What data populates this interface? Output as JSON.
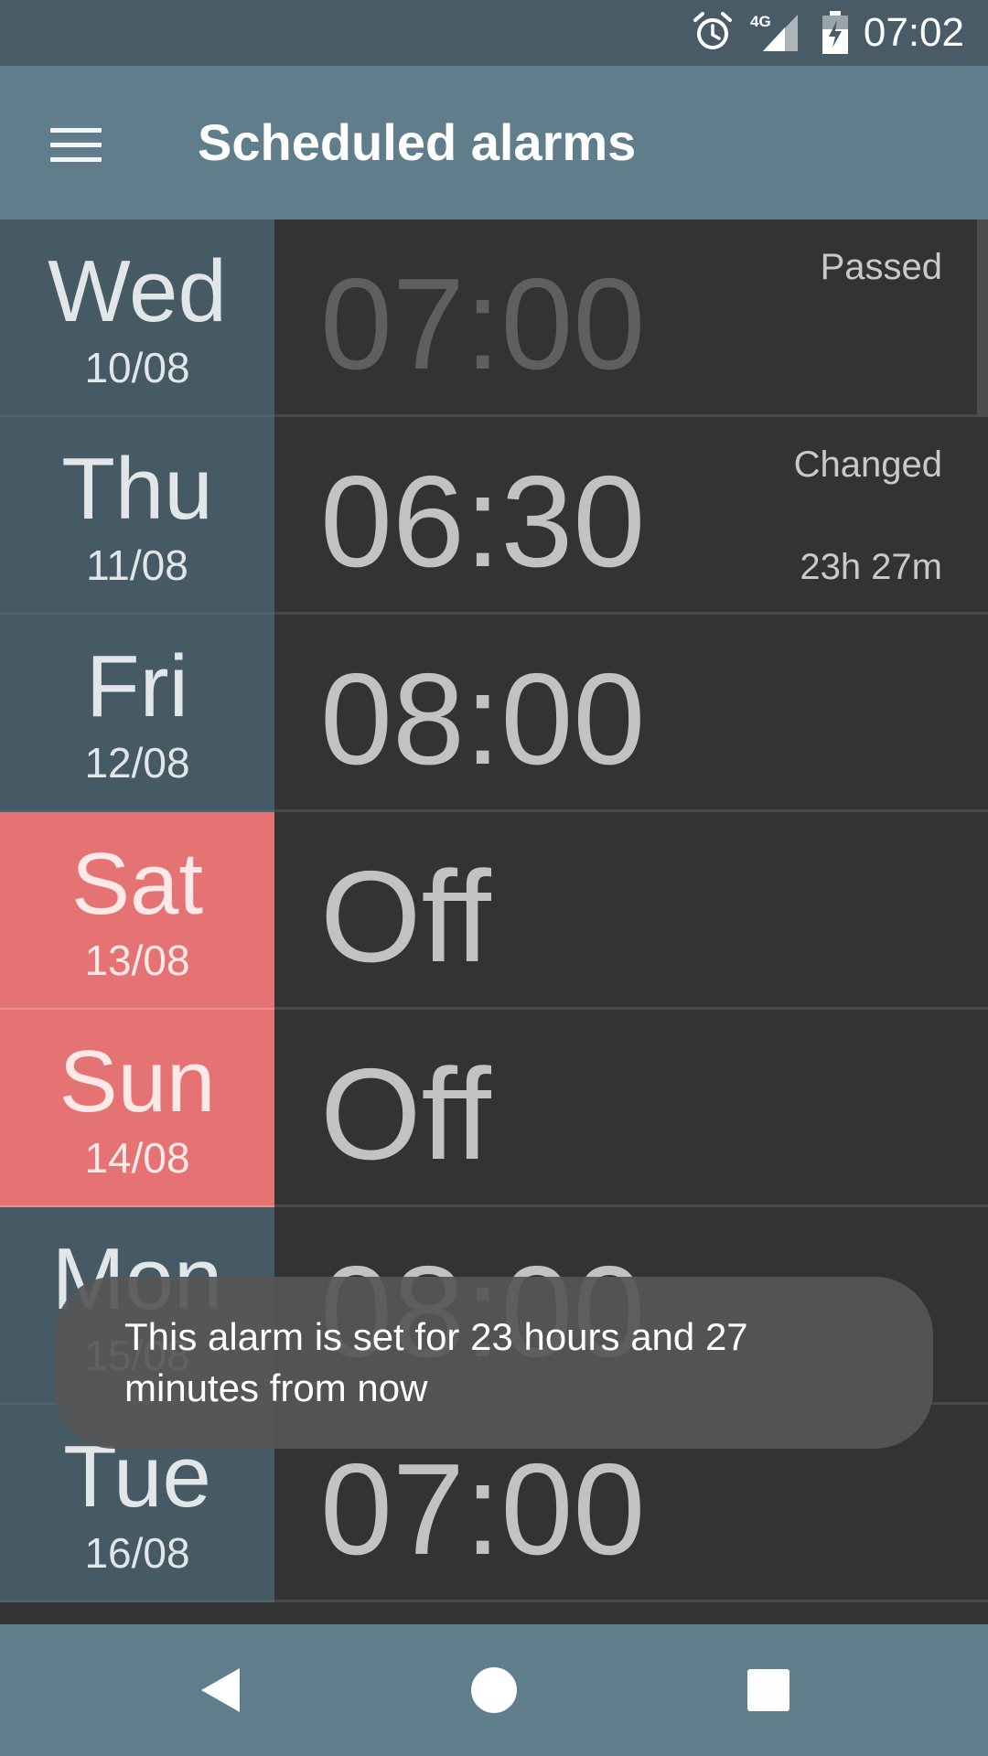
{
  "status_bar": {
    "time": "07:02",
    "network": "4G",
    "icons": [
      "alarm-clock-icon",
      "signal-4g-icon",
      "battery-charging-icon"
    ]
  },
  "app_bar": {
    "title": "Scheduled alarms",
    "menu_icon": "hamburger-menu-icon"
  },
  "alarms": [
    {
      "day": "Wed",
      "date": "10/08",
      "time": "07:00",
      "status": "Passed",
      "remaining": "",
      "weekend": false
    },
    {
      "day": "Thu",
      "date": "11/08",
      "time": "06:30",
      "status": "Changed",
      "remaining": "23h 27m",
      "weekend": false
    },
    {
      "day": "Fri",
      "date": "12/08",
      "time": "08:00",
      "status": "",
      "remaining": "",
      "weekend": false
    },
    {
      "day": "Sat",
      "date": "13/08",
      "time": "Off",
      "status": "",
      "remaining": "",
      "weekend": true
    },
    {
      "day": "Sun",
      "date": "14/08",
      "time": "Off",
      "status": "",
      "remaining": "",
      "weekend": true
    },
    {
      "day": "Mon",
      "date": "15/08",
      "time": "08:00",
      "status": "",
      "remaining": "",
      "weekend": false
    },
    {
      "day": "Tue",
      "date": "16/08",
      "time": "07:00",
      "status": "",
      "remaining": "",
      "weekend": false
    }
  ],
  "toast": {
    "message": "This alarm is set for 23 hours and 27 minutes from now"
  },
  "nav_bar": {
    "icons": [
      "back-icon",
      "home-icon",
      "recents-icon"
    ]
  },
  "colors": {
    "status_bar": "#485b67",
    "app_bar": "#607d8b",
    "weekday_cell": "#455a64",
    "weekend_cell": "#e57373",
    "time_cell": "#333333",
    "time_text": "#c2c2c2",
    "passed_time_text": "#5f5f5f"
  }
}
